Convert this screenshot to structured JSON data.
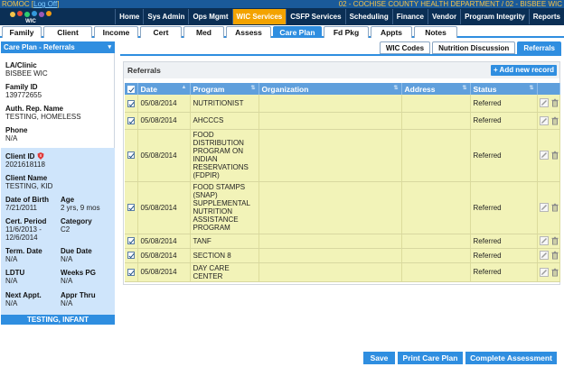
{
  "topbar": {
    "system": "ROMOC",
    "logoff": "Log Off",
    "location": "02 - COCHISE COUNTY HEALTH DEPARTMENT / 02 - BISBEE WIC"
  },
  "logo_text": "WIC",
  "menu": [
    "Home",
    "Sys Admin",
    "Ops Mgmt",
    "WIC Services",
    "CSFP Services",
    "Scheduling",
    "Finance",
    "Vendor",
    "Program Integrity",
    "Reports"
  ],
  "menu_active": "WIC Services",
  "subtabs": [
    "Family",
    "Client",
    "Income",
    "Cert",
    "Med",
    "Assess",
    "Care Plan",
    "Fd Pkg",
    "Appts",
    "Notes"
  ],
  "subtab_active": "Care Plan",
  "left": {
    "selector": "Care Plan - Referrals",
    "la_clinic_label": "LA/Clinic",
    "la_clinic_value": "BISBEE WIC",
    "family_id_label": "Family ID",
    "family_id_value": "139772655",
    "auth_rep_label": "Auth. Rep. Name",
    "auth_rep_value": "TESTING, HOMELESS",
    "phone_label": "Phone",
    "phone_value": "N/A",
    "client_id_label": "Client ID",
    "client_id_value": "2021618118",
    "client_name_label": "Client Name",
    "client_name_value": "TESTING, KID",
    "dob_label": "Date of Birth",
    "dob_value": "7/21/2011",
    "age_label": "Age",
    "age_value": "2 yrs, 9 mos",
    "cert_period_label": "Cert. Period",
    "cert_period_value": "11/6/2013 - 12/6/2014",
    "category_label": "Category",
    "category_value": "C2",
    "term_date_label": "Term. Date",
    "term_date_value": "N/A",
    "due_date_label": "Due Date",
    "due_date_value": "N/A",
    "ldtu_label": "LDTU",
    "ldtu_value": "N/A",
    "weeks_pg_label": "Weeks PG",
    "weeks_pg_value": "N/A",
    "next_appt_label": "Next Appt.",
    "next_appt_value": "N/A",
    "appr_thru_label": "Appr Thru",
    "appr_thru_value": "N/A",
    "bottom_name": "TESTING, INFANT"
  },
  "inner_tabs": [
    "WIC Codes",
    "Nutrition Discussion",
    "Referrals"
  ],
  "inner_tab_active": "Referrals",
  "referrals": {
    "title": "Referrals",
    "add_label": "+ Add new record",
    "columns": [
      "Date",
      "Program",
      "Organization",
      "Address",
      "Status"
    ],
    "rows": [
      {
        "date": "05/08/2014",
        "program": "NUTRITIONIST",
        "organization": "",
        "address": "",
        "status": "Referred"
      },
      {
        "date": "05/08/2014",
        "program": "AHCCCS",
        "organization": "",
        "address": "",
        "status": "Referred"
      },
      {
        "date": "05/08/2014",
        "program": "FOOD DISTRIBUTION PROGRAM ON INDIAN RESERVATIONS (FDPIR)",
        "organization": "",
        "address": "",
        "status": "Referred"
      },
      {
        "date": "05/08/2014",
        "program": "FOOD STAMPS (SNAP) SUPPLEMENTAL NUTRITION ASSISTANCE PROGRAM",
        "organization": "",
        "address": "",
        "status": "Referred"
      },
      {
        "date": "05/08/2014",
        "program": "TANF",
        "organization": "",
        "address": "",
        "status": "Referred"
      },
      {
        "date": "05/08/2014",
        "program": "SECTION 8",
        "organization": "",
        "address": "",
        "status": "Referred"
      },
      {
        "date": "05/08/2014",
        "program": "DAY CARE CENTER",
        "organization": "",
        "address": "",
        "status": "Referred"
      }
    ]
  },
  "buttons": {
    "save": "Save",
    "print": "Print Care Plan",
    "complete": "Complete Assessment"
  },
  "colors": {
    "accent": "#2f8ee0",
    "menubar": "#0b2f55",
    "active_menu": "#f3a300",
    "row_bg": "#f2f3b8",
    "client_box": "#cfe5fb"
  }
}
